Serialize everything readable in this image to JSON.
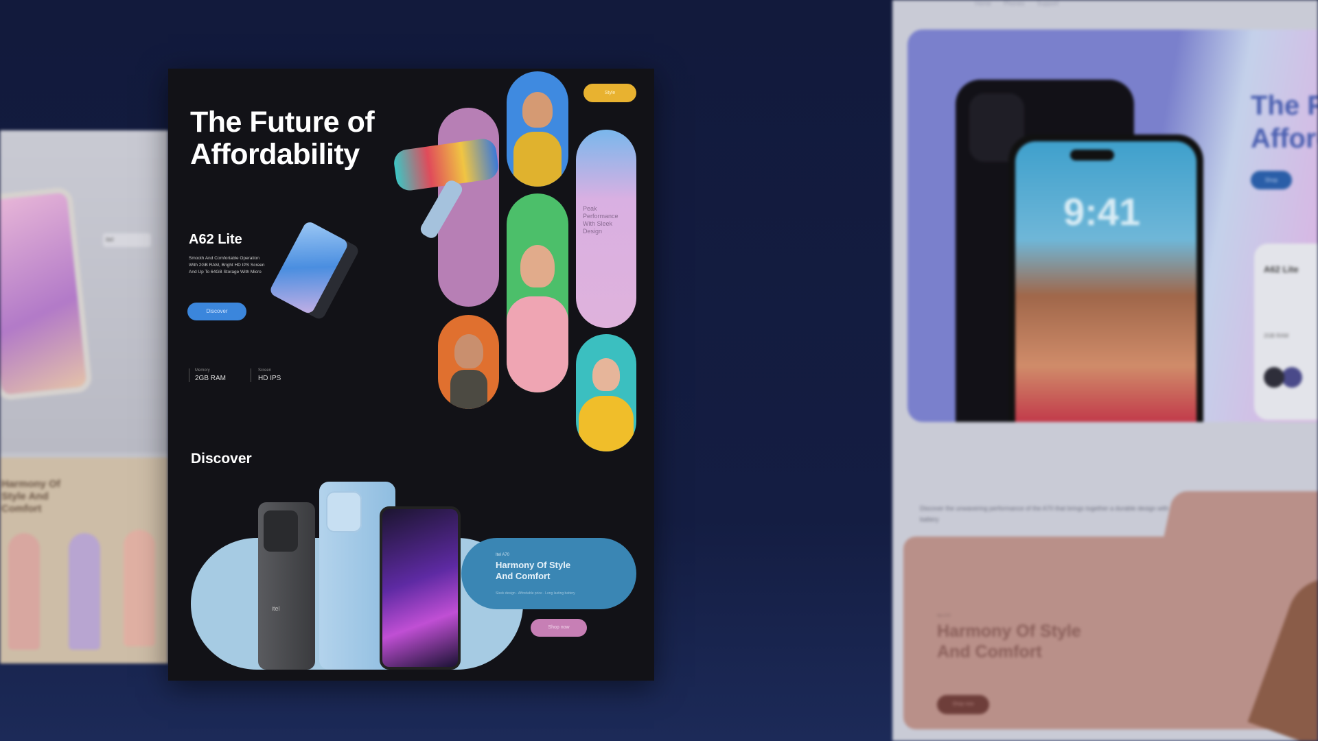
{
  "colors": {
    "background": "#121a3c",
    "card": "#121217",
    "accent_blue": "#3b86dc",
    "harmony_blue": "#3a86b4",
    "pink_button": "#c77fb5",
    "right_purple": "#7b80cc",
    "peach": "#b99089"
  },
  "left_panel": {
    "brand": "itel",
    "label": "Harmony Of Style And Comfort"
  },
  "card": {
    "title_line1": "The Future of",
    "title_line2": "Affordability",
    "product": {
      "name": "A62 Lite",
      "description": [
        "Smooth And Comfortable Operation",
        "With 2GB RAM, Bright HD IPS Screen",
        "And Up To 64GB Storage With Micro"
      ],
      "button_label": "Discover"
    },
    "specs": [
      {
        "label": "Memory",
        "value": "2GB RAM"
      },
      {
        "label": "Screen",
        "value": "HD IPS"
      }
    ],
    "tag_label": "Style",
    "feature_pill": {
      "label": "Peak Performance With Sleek Design"
    },
    "discover": {
      "heading": "Discover",
      "eyebrow": "Itel A70",
      "title_line1": "Harmony Of Style",
      "title_line2": "And Comfort",
      "subtext": "Sleek design · Affordable price · Long lasting battery",
      "button_label": "Shop now",
      "phone_brand": "itel"
    }
  },
  "right_panel": {
    "nav": [
      "Home",
      "Phones",
      "Support"
    ],
    "hero_line1": "The F",
    "hero_line2": "Afford",
    "hero_button": "Shop",
    "lock_time": "9:41",
    "card_title": "A62 Lite",
    "card_spec": "2GB RAM",
    "description": "Discover the unwavering performance of the A70 that brings together a durable design with all-day battery",
    "harmony_eyebrow": "Itel A70",
    "harmony_line1": "Harmony Of Style",
    "harmony_line2": "And Comfort",
    "harmony_button": "Shop now"
  }
}
